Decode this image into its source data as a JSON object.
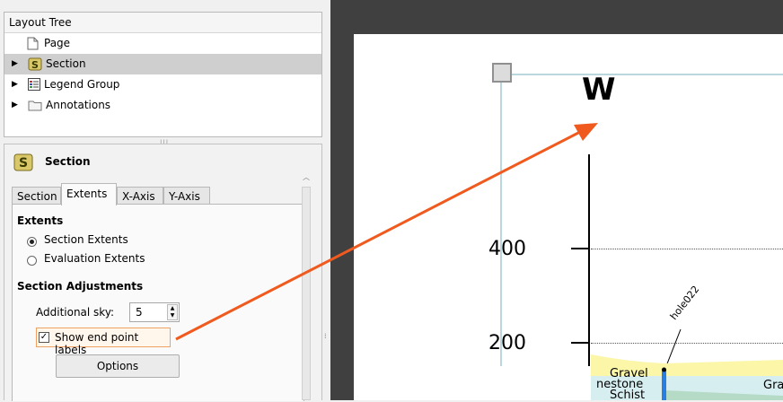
{
  "layout_tree": {
    "title": "Layout Tree",
    "items": [
      {
        "label": "Page",
        "icon": "page-icon",
        "expandable": false,
        "selected": false
      },
      {
        "label": "Section",
        "icon": "section-icon",
        "expandable": true,
        "selected": true
      },
      {
        "label": "Legend Group",
        "icon": "legend-icon",
        "expandable": true,
        "selected": false
      },
      {
        "label": "Annotations",
        "icon": "folder-icon",
        "expandable": true,
        "selected": false
      }
    ]
  },
  "properties": {
    "title": "Section",
    "tabs": [
      "Section",
      "Extents",
      "X-Axis",
      "Y-Axis"
    ],
    "active_tab": "Extents",
    "extents_heading": "Extents",
    "radio_options": [
      "Section Extents",
      "Evaluation Extents"
    ],
    "radio_selected": "Section Extents",
    "adjustments_heading": "Section Adjustments",
    "additional_sky_label": "Additional sky:",
    "additional_sky_value": "5",
    "show_end_point_labels": "Show end point labels",
    "show_end_point_labels_checked": true,
    "options_button": "Options"
  },
  "canvas": {
    "end_label": "W",
    "axis_ticks": [
      "400",
      "200"
    ],
    "drillhole_label": "hole022",
    "strata_labels": [
      "Gravel",
      "nestone",
      "Schist",
      "Gra"
    ]
  },
  "colors": {
    "callout_arrow": "#f05a1e",
    "selection_frame": "#b8d8de",
    "canvas_background": "#404040"
  }
}
